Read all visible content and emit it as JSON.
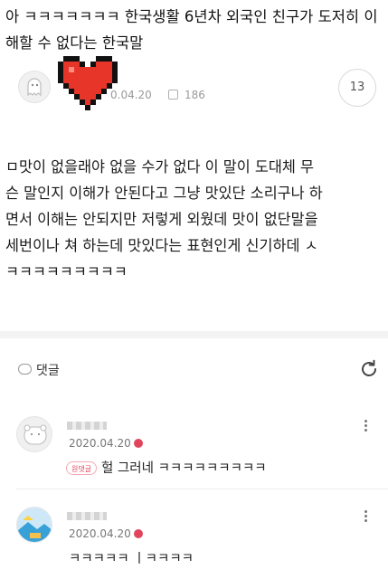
{
  "post": {
    "title": "아         ㅋㅋㅋㅋㅋㅋㅋ 한국생활 6년차 외국인 친구가 도저히 이해할 수 없다는 한국말",
    "date": "0.04.20",
    "views": "186",
    "comment_count": "13",
    "body_lines": [
      "ㅁ맛이 없을래야 없을 수가 없다 이 말이 도대체 무",
      "슨 말인지 이해가 안된다고 그냥 맛있단 소리구나 하",
      "면서 이해는 안되지만 저렇게 외웠데 맛이 없단말을",
      "세번이나 쳐 하는데 맛있다는 표현인게 신기하데 ㅅ",
      "ㅋㅋㅋㅋㅋㅋㅋㅋㅋ"
    ]
  },
  "comments_section": {
    "label": "댓글"
  },
  "comments": [
    {
      "date": "2020.04.20",
      "badge": "원댓글",
      "text": "헐 그러네 ㅋㅋㅋㅋㅋㅋㅋㅋㅋ"
    },
    {
      "date": "2020.04.20",
      "text": "ㅋㅋㅋㅋㅋ    ㅣㅋㅋㅋㅋ"
    }
  ],
  "colors": {
    "accent_red": "#e2445c",
    "heart_red": "#e8352a",
    "text_gray": "#9a9a9a"
  },
  "icons": {
    "author_avatar": "ghost-avatar-icon",
    "sticker": "pixel-heart-icon",
    "views": "view-count-icon",
    "comment_section": "speech-bubble-icon",
    "refresh": "refresh-icon",
    "more": "more-vertical-icon"
  }
}
